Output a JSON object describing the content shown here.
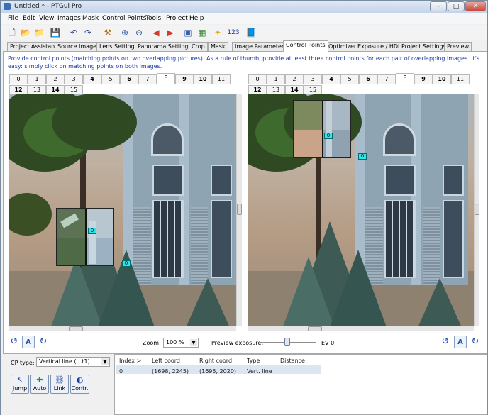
{
  "window": {
    "title": "Untitled * - PTGui Pro",
    "minimize": "–",
    "maximize": "□",
    "close": "✕"
  },
  "menu": [
    "File",
    "Edit",
    "View",
    "Images",
    "Mask",
    "Control Points",
    "Tools",
    "Project",
    "Help"
  ],
  "toolbar": {
    "icons": [
      "new-project-icon",
      "open-icon",
      "open-recent-icon",
      "save-icon",
      "undo-icon",
      "redo-icon",
      "tools-icon",
      "zoom-in-icon",
      "zoom-out-icon",
      "previous-image-icon",
      "next-image-icon",
      "panorama-editor-icon",
      "table-icon",
      "lightbulb-icon",
      "numbers-icon",
      "help-book-icon"
    ],
    "numbers_label": "123"
  },
  "tabs": [
    "Project Assistant",
    "Source Images",
    "Lens Settings",
    "Panorama Settings",
    "Crop",
    "Mask",
    "Image Parameters",
    "Control Points",
    "Optimizer",
    "Exposure / HDR",
    "Project Settings",
    "Preview"
  ],
  "active_tab": "Control Points",
  "instructions": "Provide control points (matching points on two overlapping pictures). As a rule of thumb, provide at least three control points for each pair of overlapping images. It's easy: simply click on matching points on both images.",
  "image_tabs": {
    "row1": [
      "0",
      "1",
      "2",
      "3",
      "4",
      "5",
      "6",
      "7",
      "8",
      "9",
      "10",
      "11"
    ],
    "row2": [
      "12",
      "13",
      "14",
      "15"
    ],
    "bold": [
      "4",
      "6",
      "9",
      "10",
      "14"
    ],
    "selected": "8"
  },
  "control_point_markers": {
    "left_zoom": "0",
    "left_image": "0",
    "right_zoom": "0",
    "right_image": "0"
  },
  "controls": {
    "rotate_left": "↺",
    "auto_button": "A",
    "rotate_right": "↻",
    "zoom_label": "Zoom:",
    "zoom_value": "100 %",
    "preview_exposure_label": "Preview exposure:",
    "ev_value": "EV 0"
  },
  "cp_panel": {
    "cp_type_label": "CP type:",
    "cp_type_value": "Vertical line   ( | t1)",
    "buttons": [
      {
        "label": "Jump",
        "icon": "jump-icon",
        "glyph": "↖"
      },
      {
        "label": "Auto",
        "icon": "auto-icon",
        "glyph": "✚"
      },
      {
        "label": "Link",
        "icon": "link-icon",
        "glyph": "⛓"
      },
      {
        "label": "Contr.",
        "icon": "contrast-icon",
        "glyph": "◐"
      }
    ]
  },
  "cp_table": {
    "headers": [
      "Index >",
      "Left coord",
      "Right coord",
      "Type",
      "Distance"
    ],
    "rows": [
      {
        "index": "0",
        "left": "(1698, 2245)",
        "right": "(1695, 2020)",
        "type": "Vert. line",
        "distance": ""
      }
    ]
  }
}
